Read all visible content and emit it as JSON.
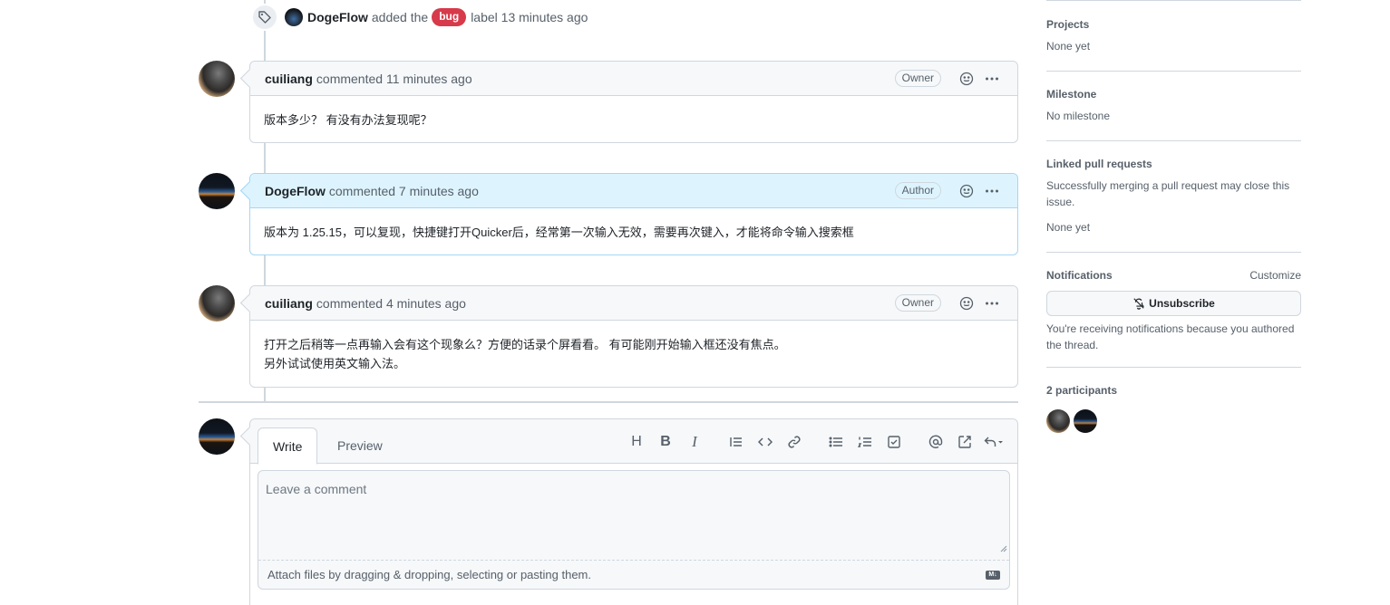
{
  "label_event": {
    "author": "DogeFlow",
    "pre_text": "added the",
    "label": "bug",
    "post_text": "label 13 minutes ago",
    "label_color": "#d73a4a"
  },
  "comments": [
    {
      "author": "cuiliang",
      "meta": "commented 11 minutes ago",
      "role": "Owner",
      "body": [
        "版本多少？ 有没有办法复现呢？"
      ]
    },
    {
      "author": "DogeFlow",
      "meta": "commented 7 minutes ago",
      "role": "Author",
      "body": [
        "版本为 1.25.15，可以复现，快捷键打开Quicker后，经常第一次输入无效，需要再次键入，才能将命令输入搜索框"
      ]
    },
    {
      "author": "cuiliang",
      "meta": "commented 4 minutes ago",
      "role": "Owner",
      "body": [
        "打开之后稍等一点再输入会有这个现象么？方便的话录个屏看看。 有可能刚开始输入框还没有焦点。",
        "另外试试使用英文输入法。"
      ]
    }
  ],
  "editor": {
    "tab_write": "Write",
    "tab_preview": "Preview",
    "placeholder": "Leave a comment",
    "attach_text": "Attach files by dragging & dropping, selecting or pasting them.",
    "toolbar_heading": "H",
    "toolbar_bold": "B",
    "toolbar_italic": "I"
  },
  "sidebar": {
    "projects_title": "Projects",
    "projects_value": "None yet",
    "milestone_title": "Milestone",
    "milestone_value": "No milestone",
    "linked_title": "Linked pull requests",
    "linked_desc": "Successfully merging a pull request may close this issue.",
    "linked_value": "None yet",
    "notifications_title": "Notifications",
    "customize_label": "Customize",
    "unsubscribe_label": "Unsubscribe",
    "notifications_desc": "You're receiving notifications because you authored the thread.",
    "participants_title": "2 participants"
  },
  "colors": {
    "author_header_bg": "#ddf4ff",
    "border": "#d0d7de",
    "muted_text": "#57606a"
  }
}
